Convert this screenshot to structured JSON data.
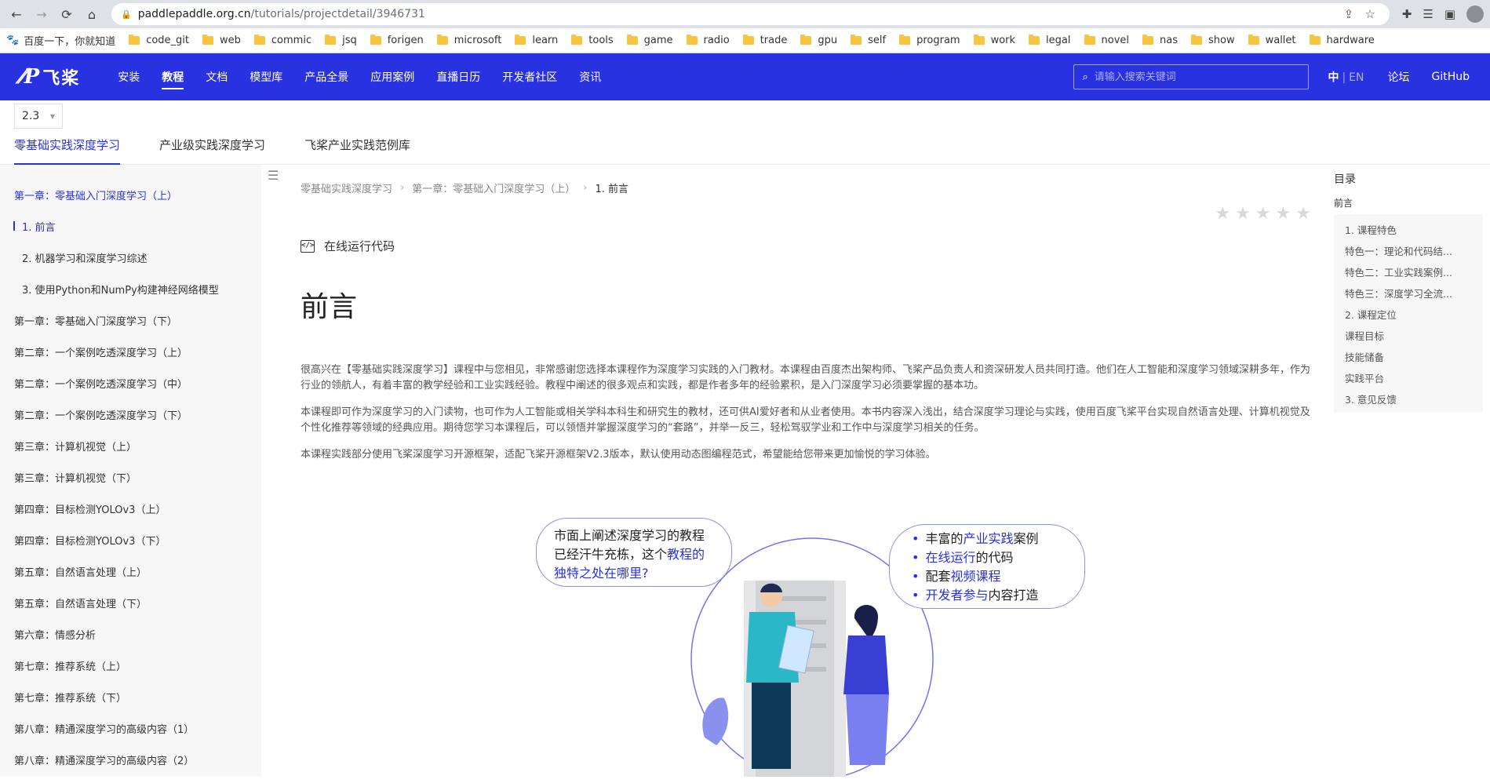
{
  "browser": {
    "url_host": "paddlepaddle.org.cn",
    "url_path": "/tutorials/projectdetail/3946731"
  },
  "bookmarks": [
    {
      "label": "百度一下，你就知道",
      "type": "paw"
    },
    {
      "label": "code_git",
      "type": "folder"
    },
    {
      "label": "web",
      "type": "folder"
    },
    {
      "label": "commic",
      "type": "folder"
    },
    {
      "label": "jsq",
      "type": "folder"
    },
    {
      "label": "forigen",
      "type": "folder"
    },
    {
      "label": "microsoft",
      "type": "folder"
    },
    {
      "label": "learn",
      "type": "folder"
    },
    {
      "label": "tools",
      "type": "folder"
    },
    {
      "label": "game",
      "type": "folder"
    },
    {
      "label": "radio",
      "type": "folder"
    },
    {
      "label": "trade",
      "type": "folder"
    },
    {
      "label": "gpu",
      "type": "folder"
    },
    {
      "label": "self",
      "type": "folder"
    },
    {
      "label": "program",
      "type": "folder"
    },
    {
      "label": "work",
      "type": "folder"
    },
    {
      "label": "legal",
      "type": "folder"
    },
    {
      "label": "novel",
      "type": "folder"
    },
    {
      "label": "nas",
      "type": "folder"
    },
    {
      "label": "show",
      "type": "folder"
    },
    {
      "label": "wallet",
      "type": "folder"
    },
    {
      "label": "hardware",
      "type": "folder"
    }
  ],
  "header": {
    "logo_text": "飞桨",
    "nav": [
      "安装",
      "教程",
      "文档",
      "模型库",
      "产品全景",
      "应用案例",
      "直播日历",
      "开发者社区",
      "资讯"
    ],
    "search_placeholder": "请输入搜索关键词",
    "lang_zh": "中",
    "lang_sep": "|",
    "lang_en": "EN",
    "forum": "论坛",
    "github": "GitHub",
    "brand_color": "#2932e1"
  },
  "version": "2.3",
  "course_tabs": [
    "零基础实践深度学习",
    "产业级实践深度学习",
    "飞桨产业实践范例库"
  ],
  "sidebar": [
    {
      "label": "第一章：零基础入门深度学习（上）",
      "kind": "chapter-active"
    },
    {
      "label": "1. 前言",
      "kind": "sub current"
    },
    {
      "label": "2. 机器学习和深度学习综述",
      "kind": "sub"
    },
    {
      "label": "3. 使用Python和NumPy构建神经网络模型",
      "kind": "sub"
    },
    {
      "label": "第一章：零基础入门深度学习（下）",
      "kind": ""
    },
    {
      "label": "第二章：一个案例吃透深度学习（上）",
      "kind": ""
    },
    {
      "label": "第二章：一个案例吃透深度学习（中）",
      "kind": ""
    },
    {
      "label": "第二章：一个案例吃透深度学习（下）",
      "kind": ""
    },
    {
      "label": "第三章：计算机视觉（上）",
      "kind": ""
    },
    {
      "label": "第三章：计算机视觉（下）",
      "kind": ""
    },
    {
      "label": "第四章：目标检测YOLOv3（上）",
      "kind": ""
    },
    {
      "label": "第四章：目标检测YOLOv3（下）",
      "kind": ""
    },
    {
      "label": "第五章：自然语言处理（上）",
      "kind": ""
    },
    {
      "label": "第五章：自然语言处理（下）",
      "kind": ""
    },
    {
      "label": "第六章：情感分析",
      "kind": ""
    },
    {
      "label": "第七章：推荐系统（上）",
      "kind": ""
    },
    {
      "label": "第七章：推荐系统（下）",
      "kind": ""
    },
    {
      "label": "第八章：精通深度学习的高级内容（1）",
      "kind": ""
    },
    {
      "label": "第八章：精通深度学习的高级内容（2）",
      "kind": ""
    }
  ],
  "breadcrumb": [
    "零基础实践深度学习",
    "第一章：零基础入门深度学习（上）",
    "1. 前言"
  ],
  "run_code_label": "在线运行代码",
  "title": "前言",
  "paragraphs": [
    "很高兴在【零基础实践深度学习】课程中与您相见，非常感谢您选择本课程作为深度学习实践的入门教材。本课程由百度杰出架构师、飞桨产品负责人和资深研发人员共同打造。他们在人工智能和深度学习领域深耕多年，作为行业的领航人，有着丰富的教学经验和工业实践经验。教程中阐述的很多观点和实践，都是作者多年的经验累积，是入门深度学习必须要掌握的基本功。",
    "本课程即可作为深度学习的入门读物，也可作为人工智能或相关学科本科生和研究生的教材，还可供AI爱好者和从业者使用。本书内容深入浅出，结合深度学习理论与实践，使用百度飞桨平台实现自然语言处理、计算机视觉及个性化推荐等领域的经典应用。期待您学习本课程后，可以领悟并掌握深度学习的“套路”，并举一反三，轻松驾驭学业和工作中与深度学习相关的任务。",
    "本课程实践部分使用飞桨深度学习开源框架，适配飞桨开源框架V2.3版本，默认使用动态图编程范式，希望能给您带来更加愉悦的学习体验。"
  ],
  "illustration": {
    "left_bubble": {
      "line1": "市面上阐述深度学习的教程",
      "line2a": "已经汗牛充栋，这个",
      "line2b": "教程的",
      "line3": "独特之处在哪里?"
    },
    "right_bubble": [
      {
        "pre": "丰富的",
        "hl": "产业实践",
        "post": "案例"
      },
      {
        "pre": "",
        "hl": "在线运行",
        "post": "的代码"
      },
      {
        "pre": "配套",
        "hl": "视频课程",
        "post": ""
      },
      {
        "pre": "",
        "hl": "开发者参与",
        "post": "内容打造"
      }
    ]
  },
  "toc": {
    "title": "目录",
    "root": "前言",
    "items": [
      "1. 课程特色",
      "特色一：理论和代码结...",
      "特色二：工业实践案例...",
      "特色三：深度学习全流...",
      "2. 课程定位",
      "课程目标",
      "技能储备",
      "实践平台",
      "3. 意见反馈"
    ]
  },
  "rating": {
    "stars": 5,
    "filled": 0
  }
}
